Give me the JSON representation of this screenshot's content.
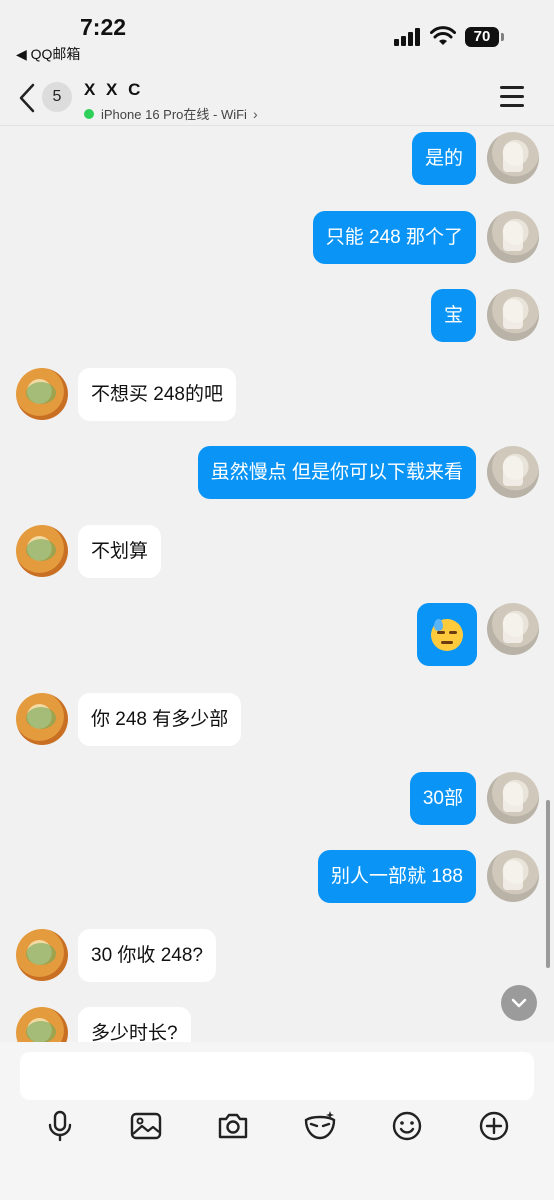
{
  "status_bar": {
    "time": "7:22",
    "back_app": "◀ QQ邮箱",
    "battery": "70"
  },
  "header": {
    "unread_count": "5",
    "contact_name": "X X C",
    "online_status": "iPhone 16 Pro在线 - WiFi",
    "online_color": "#2fd05a"
  },
  "messages": [
    {
      "sender": "me",
      "text": "是的"
    },
    {
      "sender": "me",
      "text": "只能 248 那个了"
    },
    {
      "sender": "me",
      "text": "宝"
    },
    {
      "sender": "other",
      "text": "不想买 248的吧"
    },
    {
      "sender": "me",
      "text": "虽然慢点 但是你可以下载来看"
    },
    {
      "sender": "other",
      "text": "不划算"
    },
    {
      "sender": "me",
      "emoji": "downcast-sweat-face"
    },
    {
      "sender": "other",
      "text": "你 248 有多少部"
    },
    {
      "sender": "me",
      "text": "30部"
    },
    {
      "sender": "me",
      "text": "别人一部就 188"
    },
    {
      "sender": "other",
      "text": "30 你收 248?"
    },
    {
      "sender": "other",
      "text": "多少时长?"
    }
  ],
  "input": {
    "placeholder": ""
  },
  "colors": {
    "my_bubble": "#0a94f5",
    "other_bubble": "#ffffff",
    "background": "#f1f1f1"
  },
  "toolbar_icons": [
    "microphone-icon",
    "image-icon",
    "camera-icon",
    "mask-icon",
    "emoji-icon",
    "plus-icon"
  ]
}
